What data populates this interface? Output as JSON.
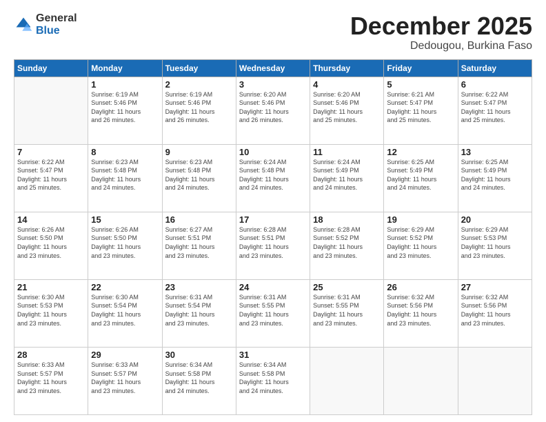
{
  "logo": {
    "general": "General",
    "blue": "Blue"
  },
  "title": "December 2025",
  "subtitle": "Dedougou, Burkina Faso",
  "days_header": [
    "Sunday",
    "Monday",
    "Tuesday",
    "Wednesday",
    "Thursday",
    "Friday",
    "Saturday"
  ],
  "weeks": [
    [
      {
        "num": "",
        "info": ""
      },
      {
        "num": "1",
        "info": "Sunrise: 6:19 AM\nSunset: 5:46 PM\nDaylight: 11 hours\nand 26 minutes."
      },
      {
        "num": "2",
        "info": "Sunrise: 6:19 AM\nSunset: 5:46 PM\nDaylight: 11 hours\nand 26 minutes."
      },
      {
        "num": "3",
        "info": "Sunrise: 6:20 AM\nSunset: 5:46 PM\nDaylight: 11 hours\nand 26 minutes."
      },
      {
        "num": "4",
        "info": "Sunrise: 6:20 AM\nSunset: 5:46 PM\nDaylight: 11 hours\nand 25 minutes."
      },
      {
        "num": "5",
        "info": "Sunrise: 6:21 AM\nSunset: 5:47 PM\nDaylight: 11 hours\nand 25 minutes."
      },
      {
        "num": "6",
        "info": "Sunrise: 6:22 AM\nSunset: 5:47 PM\nDaylight: 11 hours\nand 25 minutes."
      }
    ],
    [
      {
        "num": "7",
        "info": "Sunrise: 6:22 AM\nSunset: 5:47 PM\nDaylight: 11 hours\nand 25 minutes."
      },
      {
        "num": "8",
        "info": "Sunrise: 6:23 AM\nSunset: 5:48 PM\nDaylight: 11 hours\nand 24 minutes."
      },
      {
        "num": "9",
        "info": "Sunrise: 6:23 AM\nSunset: 5:48 PM\nDaylight: 11 hours\nand 24 minutes."
      },
      {
        "num": "10",
        "info": "Sunrise: 6:24 AM\nSunset: 5:48 PM\nDaylight: 11 hours\nand 24 minutes."
      },
      {
        "num": "11",
        "info": "Sunrise: 6:24 AM\nSunset: 5:49 PM\nDaylight: 11 hours\nand 24 minutes."
      },
      {
        "num": "12",
        "info": "Sunrise: 6:25 AM\nSunset: 5:49 PM\nDaylight: 11 hours\nand 24 minutes."
      },
      {
        "num": "13",
        "info": "Sunrise: 6:25 AM\nSunset: 5:49 PM\nDaylight: 11 hours\nand 24 minutes."
      }
    ],
    [
      {
        "num": "14",
        "info": "Sunrise: 6:26 AM\nSunset: 5:50 PM\nDaylight: 11 hours\nand 23 minutes."
      },
      {
        "num": "15",
        "info": "Sunrise: 6:26 AM\nSunset: 5:50 PM\nDaylight: 11 hours\nand 23 minutes."
      },
      {
        "num": "16",
        "info": "Sunrise: 6:27 AM\nSunset: 5:51 PM\nDaylight: 11 hours\nand 23 minutes."
      },
      {
        "num": "17",
        "info": "Sunrise: 6:28 AM\nSunset: 5:51 PM\nDaylight: 11 hours\nand 23 minutes."
      },
      {
        "num": "18",
        "info": "Sunrise: 6:28 AM\nSunset: 5:52 PM\nDaylight: 11 hours\nand 23 minutes."
      },
      {
        "num": "19",
        "info": "Sunrise: 6:29 AM\nSunset: 5:52 PM\nDaylight: 11 hours\nand 23 minutes."
      },
      {
        "num": "20",
        "info": "Sunrise: 6:29 AM\nSunset: 5:53 PM\nDaylight: 11 hours\nand 23 minutes."
      }
    ],
    [
      {
        "num": "21",
        "info": "Sunrise: 6:30 AM\nSunset: 5:53 PM\nDaylight: 11 hours\nand 23 minutes."
      },
      {
        "num": "22",
        "info": "Sunrise: 6:30 AM\nSunset: 5:54 PM\nDaylight: 11 hours\nand 23 minutes."
      },
      {
        "num": "23",
        "info": "Sunrise: 6:31 AM\nSunset: 5:54 PM\nDaylight: 11 hours\nand 23 minutes."
      },
      {
        "num": "24",
        "info": "Sunrise: 6:31 AM\nSunset: 5:55 PM\nDaylight: 11 hours\nand 23 minutes."
      },
      {
        "num": "25",
        "info": "Sunrise: 6:31 AM\nSunset: 5:55 PM\nDaylight: 11 hours\nand 23 minutes."
      },
      {
        "num": "26",
        "info": "Sunrise: 6:32 AM\nSunset: 5:56 PM\nDaylight: 11 hours\nand 23 minutes."
      },
      {
        "num": "27",
        "info": "Sunrise: 6:32 AM\nSunset: 5:56 PM\nDaylight: 11 hours\nand 23 minutes."
      }
    ],
    [
      {
        "num": "28",
        "info": "Sunrise: 6:33 AM\nSunset: 5:57 PM\nDaylight: 11 hours\nand 23 minutes."
      },
      {
        "num": "29",
        "info": "Sunrise: 6:33 AM\nSunset: 5:57 PM\nDaylight: 11 hours\nand 23 minutes."
      },
      {
        "num": "30",
        "info": "Sunrise: 6:34 AM\nSunset: 5:58 PM\nDaylight: 11 hours\nand 24 minutes."
      },
      {
        "num": "31",
        "info": "Sunrise: 6:34 AM\nSunset: 5:58 PM\nDaylight: 11 hours\nand 24 minutes."
      },
      {
        "num": "",
        "info": ""
      },
      {
        "num": "",
        "info": ""
      },
      {
        "num": "",
        "info": ""
      }
    ]
  ]
}
